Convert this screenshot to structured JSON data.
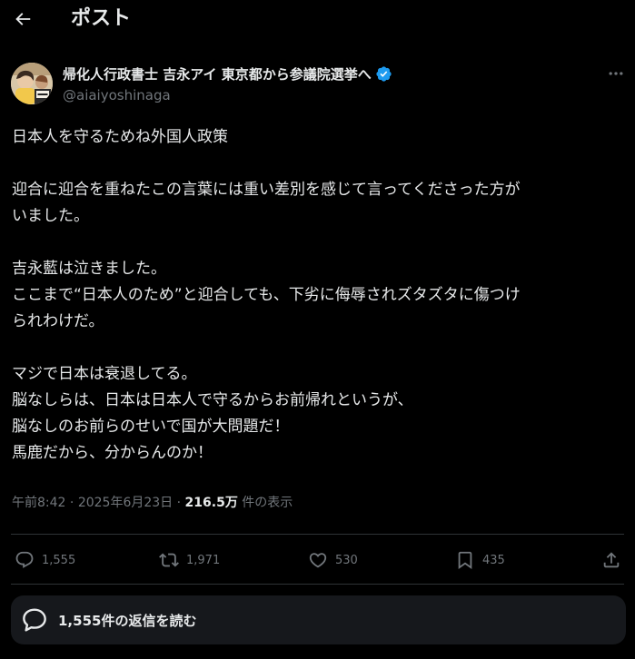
{
  "header": {
    "title": "ポスト"
  },
  "author": {
    "display_name": "帰化人行政書士 吉永アイ 東京都から参議院選挙へ",
    "handle": "@aiaiyoshinaga",
    "avatar_caption": "吉永アイ"
  },
  "tweet": {
    "lines": [
      "日本人を守るためね外国人政策",
      "",
      "迎合に迎合を重ねたこの言葉には重い差別を感じて言ってくださった方が",
      "いました。",
      "",
      "吉永藍は泣きました。",
      "ここまで“日本人のため”と迎合しても、下劣に侮辱されズタズタに傷つけ",
      "られわけだ。",
      "",
      "マジで日本は衰退してる。",
      "脳なしらは、日本は日本人で守るからお前帰れというが、",
      "脳なしのお前らのせいで国が大問題だ！",
      "馬鹿だから、分からんのか！"
    ]
  },
  "meta": {
    "time": "午前8:42",
    "separator": " · ",
    "date": "2025年6月23日",
    "views_count": "216.5万",
    "views_label": " 件の表示"
  },
  "actions": {
    "replies": "1,555",
    "reposts": "1,971",
    "likes": "530",
    "bookmarks": "435"
  },
  "read_replies": {
    "label": "1,555件の返信を読む"
  },
  "icons": {
    "back": "arrow-left-icon",
    "verified": "verified-badge-icon",
    "more": "more-horizontal-icon",
    "reply": "comment-bubble-icon",
    "repost": "repost-icon",
    "like": "heart-icon",
    "bookmark": "bookmark-icon",
    "share": "share-icon",
    "replies_button": "chat-bubble-icon"
  },
  "colors": {
    "background": "#000000",
    "text": "#e7e9ea",
    "secondary": "#71767b",
    "verified": "#1d9bf0",
    "divider": "#2f3336",
    "button_bg": "#16181c"
  }
}
